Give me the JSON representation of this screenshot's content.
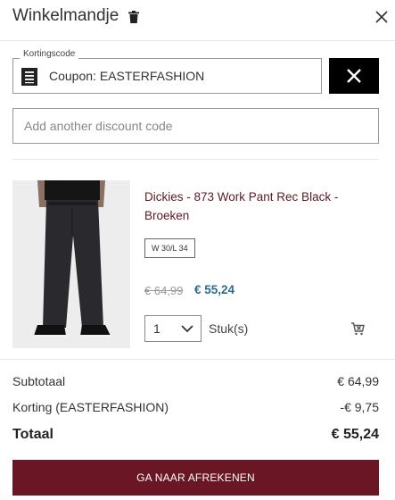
{
  "header": {
    "title": "Winkelmandje",
    "trash_icon": "trash-icon",
    "close_icon": "close-icon"
  },
  "coupon": {
    "legend": "Kortingscode",
    "value": "Coupon: EASTERFASHION",
    "icon": "receipt-icon",
    "remove_icon": "close-icon"
  },
  "discount_input": {
    "placeholder": "Add another discount code",
    "value": ""
  },
  "cart_item": {
    "name": "Dickies - 873 Work Pant Rec Black - Broeken",
    "size": "W 30/L 34",
    "price_old": "€ 64,99",
    "price_new": "€ 55,24",
    "quantity": "1",
    "unit": "Stuk(s)",
    "remove_icon": "cart-remove-icon"
  },
  "summary": {
    "subtotal_label": "Subtotaal",
    "subtotal_value": "€ 64,99",
    "discount_label": "Korting (EASTERFASHION)",
    "discount_value": "-€ 9,75",
    "total_label": "Totaal",
    "total_value": "€ 55,24"
  },
  "checkout_label": "GA NAAR AFREKENEN",
  "colors": {
    "accent": "#6b1624",
    "product_name": "#5c1a26",
    "sale_price": "#2a6d8f"
  }
}
